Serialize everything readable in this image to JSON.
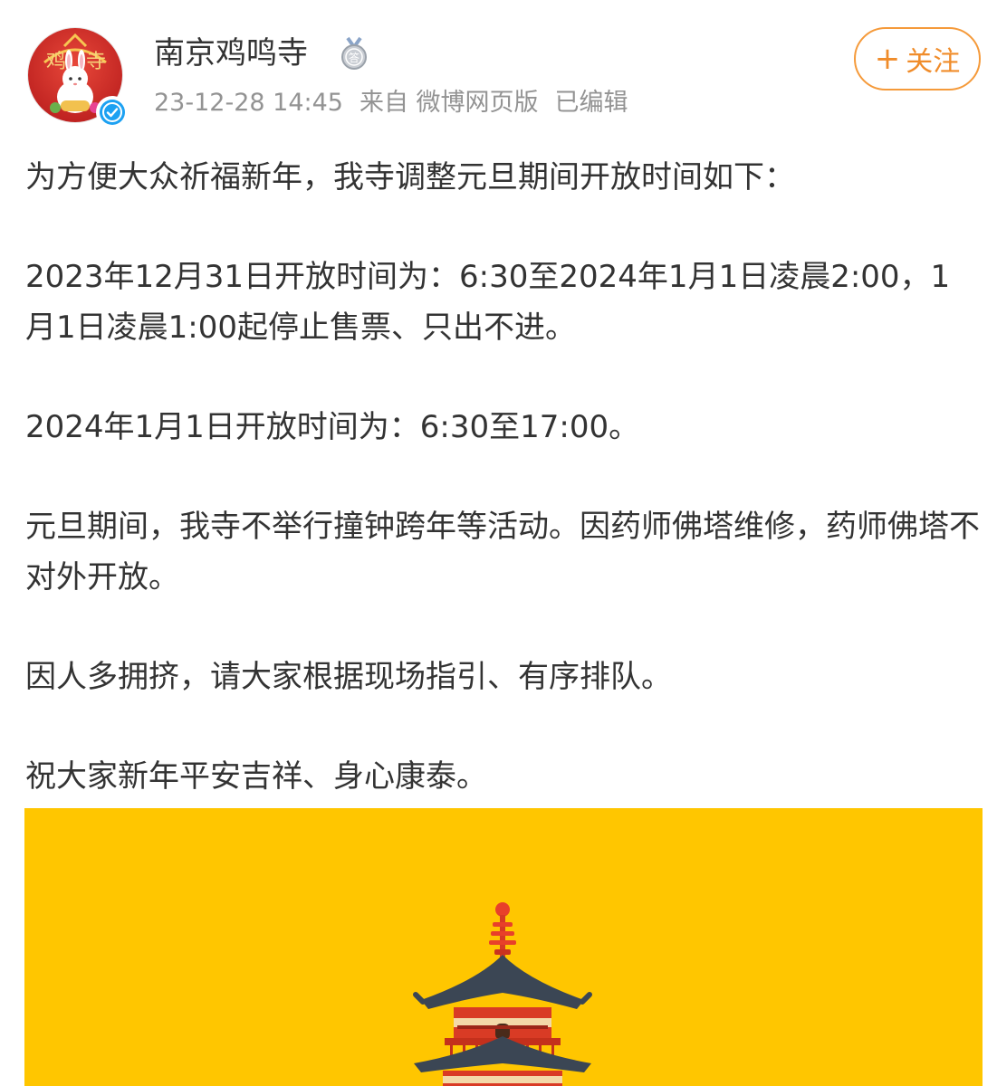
{
  "post": {
    "user": {
      "name": "南京鸡鸣寺",
      "avatar_icon": "avatar-temple-rabbit",
      "verified_icon": "verified-badge-icon",
      "medal_icon": "silver-medal-icon"
    },
    "meta": {
      "time": "23-12-28 14:45",
      "source": "来自 微博网页版",
      "edited": "已编辑"
    },
    "follow_button": {
      "plus": "+",
      "label": "关注"
    },
    "paragraphs": [
      "为方便大众祈福新年，我寺调整元旦期间开放时间如下：",
      "2023年12月31日开放时间为：6:30至2024年1月1日凌晨2:00，1月1日凌晨1:00起停止售票、只出不进。",
      "2024年1月1日开放时间为：6:30至17:00。",
      "元旦期间，我寺不举行撞钟跨年等活动。因药师佛塔维修，药师佛塔不对外开放。",
      "因人多拥挤，请大家根据现场指引、有序排队。",
      "祝大家新年平安吉祥、身心康泰。"
    ],
    "image": {
      "background": "#ffc600",
      "subject_icon": "pagoda-illustration"
    }
  },
  "colors": {
    "accent": "#f08c2a",
    "text": "#333333",
    "meta": "#939393"
  }
}
